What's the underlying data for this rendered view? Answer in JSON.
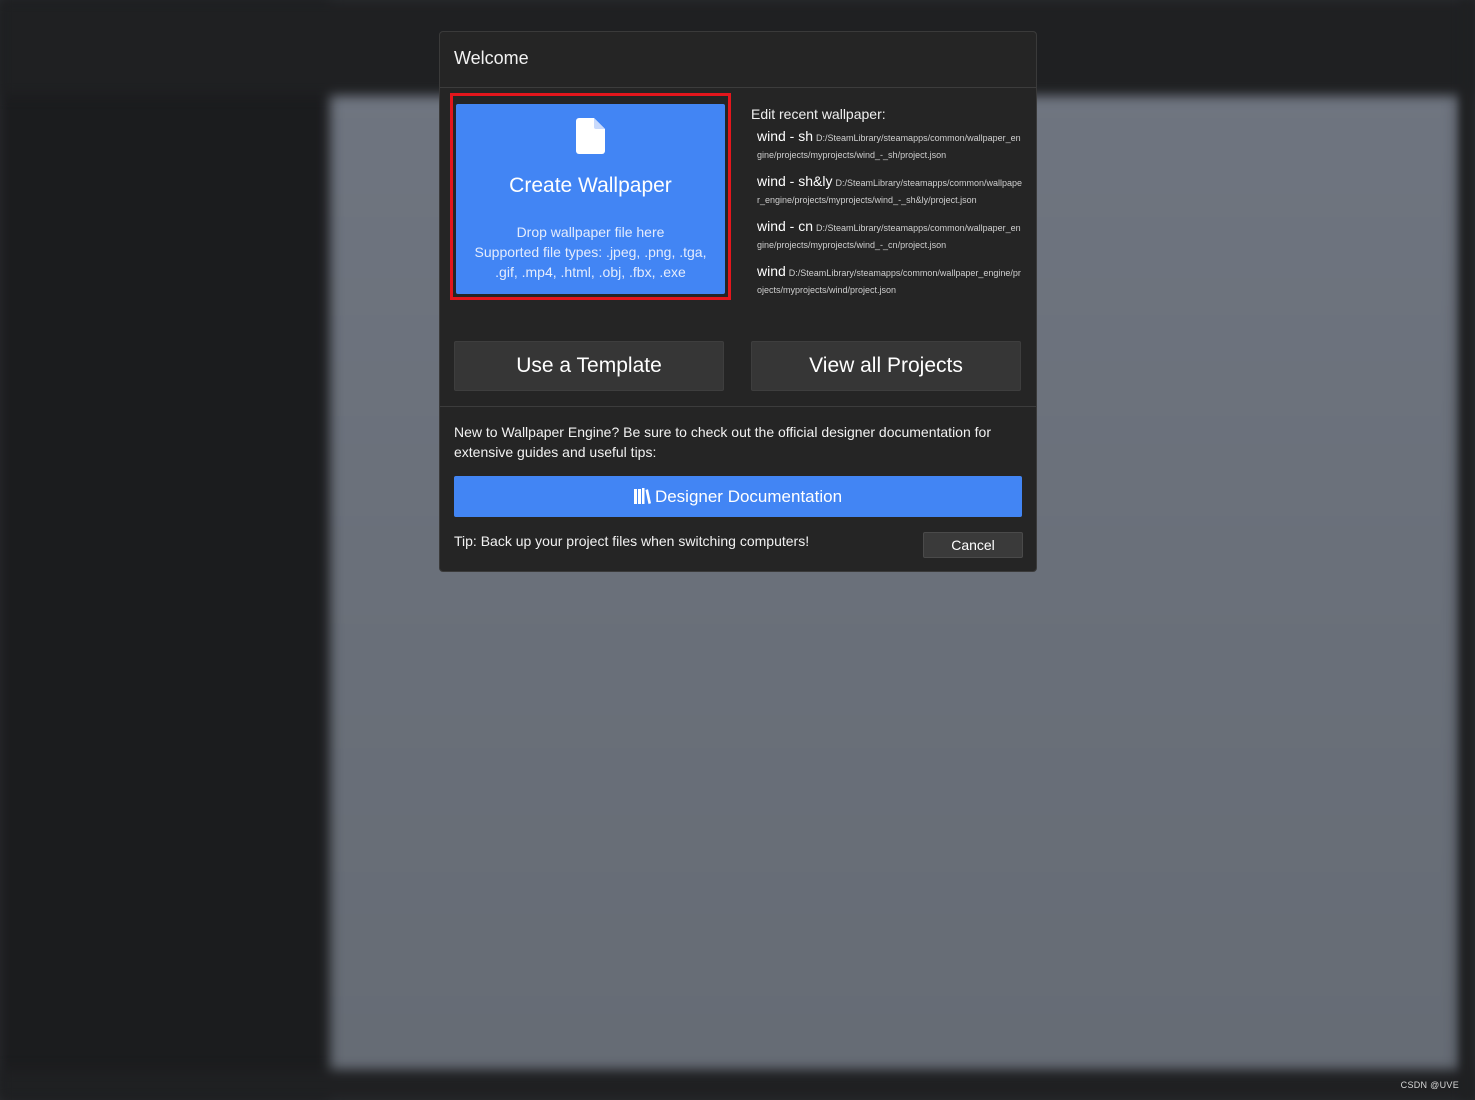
{
  "dialog": {
    "title": "Welcome"
  },
  "create": {
    "title": "Create Wallpaper",
    "drop_text": "Drop wallpaper file here",
    "types_text": "Supported file types: .jpeg, .png, .tga, .gif, .mp4, .html, .obj, .fbx, .exe",
    "icon": "file-icon"
  },
  "recent": {
    "heading": "Edit recent wallpaper:",
    "items": [
      {
        "name": "wind - sh",
        "path": "D:/SteamLibrary/steamapps/common/wallpaper_engine/projects/myprojects/wind_-_sh/project.json"
      },
      {
        "name": "wind - sh&ly",
        "path": "D:/SteamLibrary/steamapps/common/wallpaper_engine/projects/myprojects/wind_-_sh&ly/project.json"
      },
      {
        "name": "wind - cn",
        "path": "D:/SteamLibrary/steamapps/common/wallpaper_engine/projects/myprojects/wind_-_cn/project.json"
      },
      {
        "name": "wind",
        "path": "D:/SteamLibrary/steamapps/common/wallpaper_engine/projects/myprojects/wind/project.json"
      }
    ]
  },
  "buttons": {
    "template": "Use a Template",
    "projects": "View all Projects",
    "docs": "Designer Documentation",
    "cancel": "Cancel"
  },
  "info": "New to Wallpaper Engine? Be sure to check out the official designer documentation for extensive guides and useful tips:",
  "tip": "Tip: Back up your project files when switching computers!",
  "watermark": "CSDN @UVE",
  "colors": {
    "accent": "#4285f4",
    "highlight_border": "#e3161c",
    "dialog_bg": "#252525"
  }
}
